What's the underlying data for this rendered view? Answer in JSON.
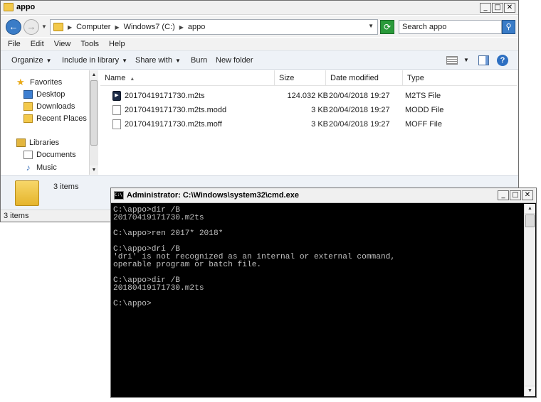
{
  "explorer": {
    "title": "appo",
    "address": {
      "crumbs": [
        "Computer",
        "Windows7 (C:)",
        "appo"
      ]
    },
    "search_placeholder": "Search appo",
    "menu": [
      "File",
      "Edit",
      "View",
      "Tools",
      "Help"
    ],
    "toolbar": {
      "organize": "Organize",
      "include": "Include in library",
      "share": "Share with",
      "burn": "Burn",
      "new_folder": "New folder"
    },
    "nav": {
      "favorites": "Favorites",
      "desktop": "Desktop",
      "downloads": "Downloads",
      "recent": "Recent Places",
      "libraries": "Libraries",
      "documents": "Documents",
      "music": "Music"
    },
    "columns": {
      "name": "Name",
      "size": "Size",
      "date": "Date modified",
      "type": "Type"
    },
    "files": [
      {
        "name": "20170419171730.m2ts",
        "size": "124.032 KB",
        "date": "20/04/2018 19:27",
        "type": "M2TS File"
      },
      {
        "name": "20170419171730.m2ts.modd",
        "size": "3 KB",
        "date": "20/04/2018 19:27",
        "type": "MODD File"
      },
      {
        "name": "20170419171730.m2ts.moff",
        "size": "3 KB",
        "date": "20/04/2018 19:27",
        "type": "MOFF File"
      }
    ],
    "details_count": "3 items",
    "status": "3 items"
  },
  "cmd": {
    "title": "Administrator: C:\\Windows\\system32\\cmd.exe",
    "icon_label": "C:\\",
    "lines": [
      "C:\\appo>dir /B",
      "20170419171730.m2ts",
      "",
      "C:\\appo>ren 2017* 2018*",
      "",
      "C:\\appo>dri /B",
      "'dri' is not recognized as an internal or external command,",
      "operable program or batch file.",
      "",
      "C:\\appo>dir /B",
      "20180419171730.m2ts",
      "",
      "C:\\appo>"
    ]
  }
}
